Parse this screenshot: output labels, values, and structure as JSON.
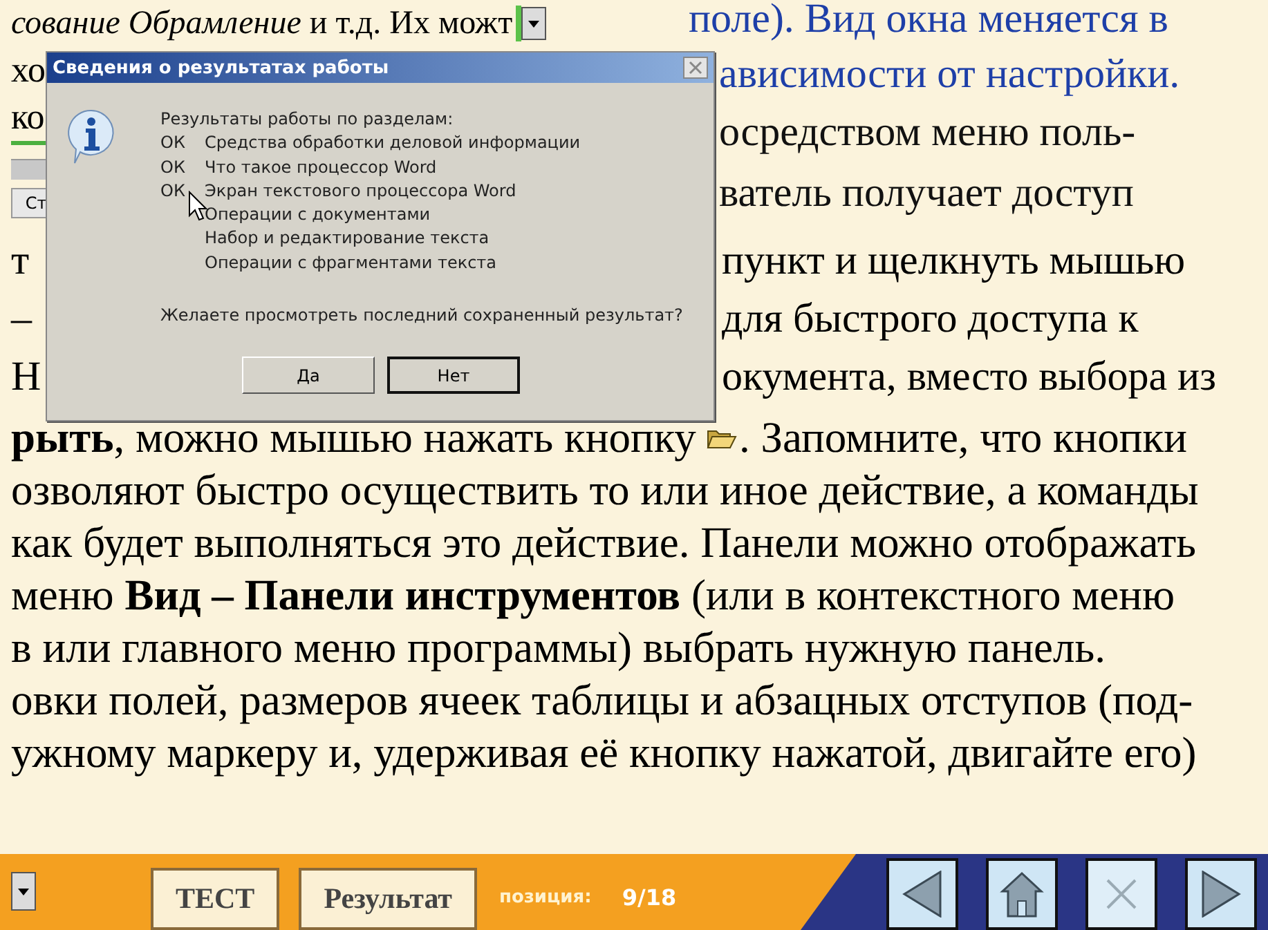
{
  "document": {
    "left_top": [
      "*сование* *Обрамление* и т.д. Их можт",
      "хо",
      "ко"
    ],
    "left_button": "Ст",
    "right_top": [
      {
        "text": "поле). Вид окна меняется в",
        "kind": "link"
      },
      {
        "text": "ависимости от настройки.",
        "kind": "link"
      },
      {
        "text": "осредством  меню поль-",
        "kind": "plain"
      },
      {
        "text": "ватель получает доступ",
        "kind": "plain"
      }
    ],
    "split_lines": [
      {
        "left": "т",
        "right": "пункт и щелкнуть мышью"
      },
      {
        "left": "–",
        "right": "для быстрого доступа к"
      },
      {
        "left": "Н",
        "right": "окумента, вместо выбора из"
      }
    ],
    "icon_line": {
      "before": "**рыть**, можно мышью нажать кнопку",
      "after": ". Запомните, что кнопки"
    },
    "lines": [
      "озволяют быстро осуществить то или иное действие, а команды",
      "как будет выполняться это действие. Панели можно отображать",
      "меню **Вид – Панели инструментов** (или в контекстного меню",
      "в или главного меню программы) выбрать нужную панель.",
      "овки полей, размеров ячеек таблицы и абзацных отступов (под-",
      "ужному маркеру и, удерживая её кнопку нажатой, двигайте его)"
    ]
  },
  "dialog": {
    "title": "Сведения о результатах работы",
    "heading": "Результаты работы по разделам:",
    "sections": [
      {
        "status": "ОК",
        "name": "Средства обработки деловой информации"
      },
      {
        "status": "ОК",
        "name": "Что такое процессор Word"
      },
      {
        "status": "ОК",
        "name": "Экран текстового процессора Word"
      },
      {
        "name": "Операции с документами"
      },
      {
        "name": "Набор и редактирование текста"
      },
      {
        "name": "Операции с фрагментами текста"
      }
    ],
    "question": "Желаете просмотреть последний сохраненный результат?",
    "buttons": [
      {
        "label": "Да",
        "selected": false
      },
      {
        "label": "Нет",
        "selected": true
      }
    ]
  },
  "bottom_bar": {
    "buttons": [
      "ТЕСТ",
      "Результат"
    ],
    "position_label": "позиция:",
    "position": "9/18",
    "nav": [
      {
        "kind": "back",
        "disabled": false
      },
      {
        "kind": "home",
        "disabled": false
      },
      {
        "kind": "close",
        "disabled": true
      },
      {
        "kind": "forward",
        "disabled": false
      }
    ]
  }
}
